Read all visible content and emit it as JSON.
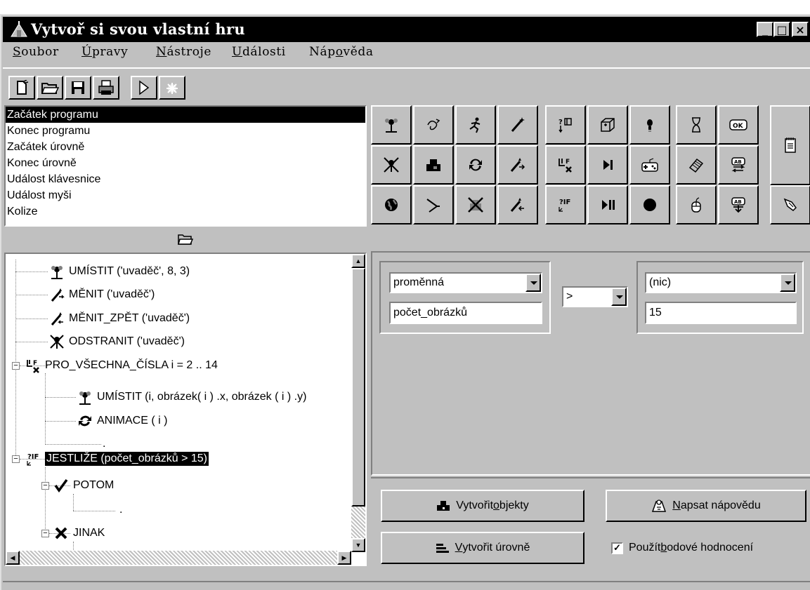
{
  "window": {
    "title": "Vytvoř si svou vlastní hru",
    "controls": {
      "minimize": "_",
      "maximize": "□",
      "close": "×"
    }
  },
  "menubar": {
    "items": [
      {
        "prefix": "",
        "hot": "S",
        "rest": "oubor"
      },
      {
        "prefix": "",
        "hot": "Ú",
        "rest": "pravy"
      },
      {
        "prefix": "",
        "hot": "N",
        "rest": "ástroje"
      },
      {
        "prefix": "",
        "hot": "U",
        "rest": "dálosti"
      },
      {
        "prefix": "Náp",
        "hot": "o",
        "rest": "věda"
      }
    ]
  },
  "toolbar": {
    "buttons": [
      "new-file-icon",
      "open-folder-icon",
      "save-icon",
      "print-icon",
      "play-icon",
      "stop-animation-icon"
    ]
  },
  "events": {
    "items": [
      "Začátek programu",
      "Konec programu",
      "Začátek úrovně",
      "Konec úrovně",
      "Událost klávesnice",
      "Událost myši",
      "Kolize"
    ],
    "selected": 0
  },
  "tree": {
    "rows": [
      {
        "label": "UMÍSTIT ('uvaděč', 8, 3)",
        "icon": "flower-icon"
      },
      {
        "label": "MĚNIT ('uvaděč')",
        "icon": "wand-forward-icon"
      },
      {
        "label": "MĚNIT_ZPĚT ('uvaděč')",
        "icon": "wand-back-icon"
      },
      {
        "label": "ODSTRANIT ('uvaděč')",
        "icon": "remove-icon"
      },
      {
        "label": "PRO_VŠECHNA_ČÍSLA i = 2 .. 14",
        "icon": "loop-icon"
      },
      {
        "label": "UMÍSTIT (i, obrázek( i ) .x, obrázek ( i ) .y)",
        "icon": "flower-icon"
      },
      {
        "label": "ANIMACE ( i )",
        "icon": "animate-icon"
      },
      {
        "label": ".",
        "icon": ""
      },
      {
        "label": "JESTLIŽE (počet_obrázků > 15)",
        "icon": "if-icon"
      },
      {
        "label": "POTOM",
        "icon": "check-icon"
      },
      {
        "label": ".",
        "icon": ""
      },
      {
        "label": "JINAK",
        "icon": "cross-icon"
      }
    ]
  },
  "commands": {
    "buttons": [
      "flower-icon",
      "swirl-icon",
      "runner-icon",
      "wand-icon",
      "swap-if-icon",
      "cube-icon",
      "bulb-icon",
      "hourglass-icon",
      "ok-icon",
      "remove-icon",
      "blocks-icon",
      "animate-icon",
      "wand-forward-icon",
      "loop-icon",
      "step-icon",
      "gamepad-icon",
      "eraser-icon",
      "text-swap-icon",
      "globe-icon",
      "throw-icon",
      "remove-all-icon",
      "wand-back-icon",
      "if-icon",
      "pause-icon",
      "stop-icon",
      "mouse-icon",
      "text-down-icon",
      "notepad-icon",
      "pointer-icon"
    ]
  },
  "condition": {
    "left_combo": "proměnná",
    "left_value": "počet_obrázků",
    "operator": ">",
    "right_combo": "(nic)",
    "right_value": "15"
  },
  "bottom": {
    "create_objects": {
      "pre": "Vytvořit ",
      "hot": "o",
      "post": "bjekty"
    },
    "write_help": {
      "pre": "",
      "hot": "N",
      "post": "apsat nápovědu"
    },
    "create_levels": {
      "pre": "",
      "hot": "V",
      "post": "ytvořit úrovně"
    },
    "use_scoring": {
      "pre": "Použít ",
      "hot": "b",
      "post": "odové hodnocení",
      "checked": "✓"
    }
  },
  "colors": {
    "face": "#c0c0c0",
    "highlight": "#ffffff",
    "shadow": "#808080",
    "dark": "#000000",
    "titlebar": "#000000"
  }
}
